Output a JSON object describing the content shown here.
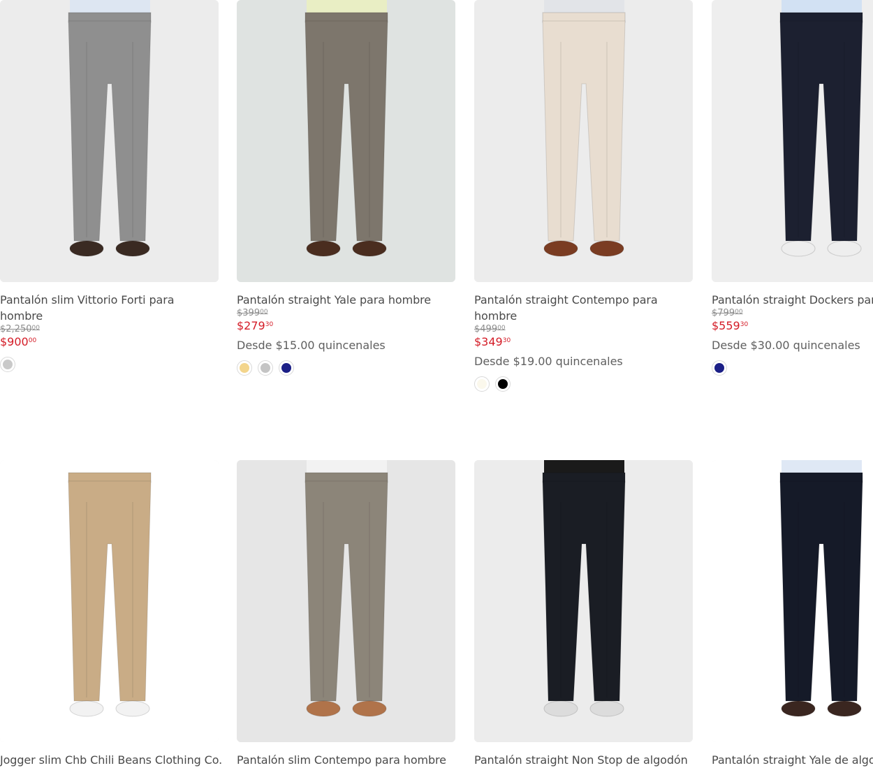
{
  "products": [
    {
      "title": "Pantalón slim Vittorio Forti para hombre",
      "old_price": "$2,250",
      "old_cents": "00",
      "price": "$900",
      "cents": "00",
      "installments": "",
      "swatches": [
        "#c9c9c9"
      ],
      "colors": {
        "bg": "#ececec",
        "pants": "#8f8f8f",
        "shoes": "#3a2a22",
        "shirt": "#dde6f2"
      }
    },
    {
      "title": "Pantalón straight Yale para hombre",
      "old_price": "$399",
      "old_cents": "00",
      "price": "$279",
      "cents": "30",
      "installments": "Desde $15.00 quincenales",
      "swatches": [
        "#f3d58c",
        "#c4c4c4",
        "#1b1f86"
      ],
      "colors": {
        "bg": "#dfe3e1",
        "pants": "#7d766c",
        "shoes": "#4a2d1f",
        "shirt": "#e9eec4"
      }
    },
    {
      "title": "Pantalón straight Contempo para hombre",
      "old_price": "$499",
      "old_cents": "00",
      "price": "$349",
      "cents": "30",
      "installments": "Desde $19.00 quincenales",
      "swatches": [
        "#fbf8ec",
        "#000000"
      ],
      "colors": {
        "bg": "#ececec",
        "pants": "#e8ddd0",
        "shoes": "#7a3c22",
        "shirt": "#e2e4e8"
      }
    },
    {
      "title": "Pantalón straight Dockers para hombre",
      "old_price": "$799",
      "old_cents": "00",
      "price": "$559",
      "cents": "30",
      "installments": "Desde $30.00 quincenales",
      "swatches": [
        "#1b1f86"
      ],
      "colors": {
        "bg": "#eeeeee",
        "pants": "#1c2030",
        "shoes": "#eeeeee",
        "shirt": "#d2e1f3"
      }
    },
    {
      "title": "Jogger slim Chb Chili Beans Clothing Co.",
      "colors": {
        "bg": "#ffffff",
        "pants": "#c9ac86",
        "shoes": "#f2f2f2",
        "shirt": "#ffffff"
      }
    },
    {
      "title": "Pantalón slim Contempo para hombre",
      "colors": {
        "bg": "#e6e6e6",
        "pants": "#8c8579",
        "shoes": "#b0734a",
        "shirt": "#f2f2f2"
      }
    },
    {
      "title": "Pantalón straight Non Stop de algodón",
      "colors": {
        "bg": "#ececec",
        "pants": "#1a1d24",
        "shoes": "#dcdcdc",
        "shirt": "#1a1a1a"
      }
    },
    {
      "title": "Pantalón straight Yale de algodón",
      "colors": {
        "bg": "#ffffff",
        "pants": "#151a28",
        "shoes": "#3a2620",
        "shirt": "#dfe8f5"
      }
    }
  ]
}
